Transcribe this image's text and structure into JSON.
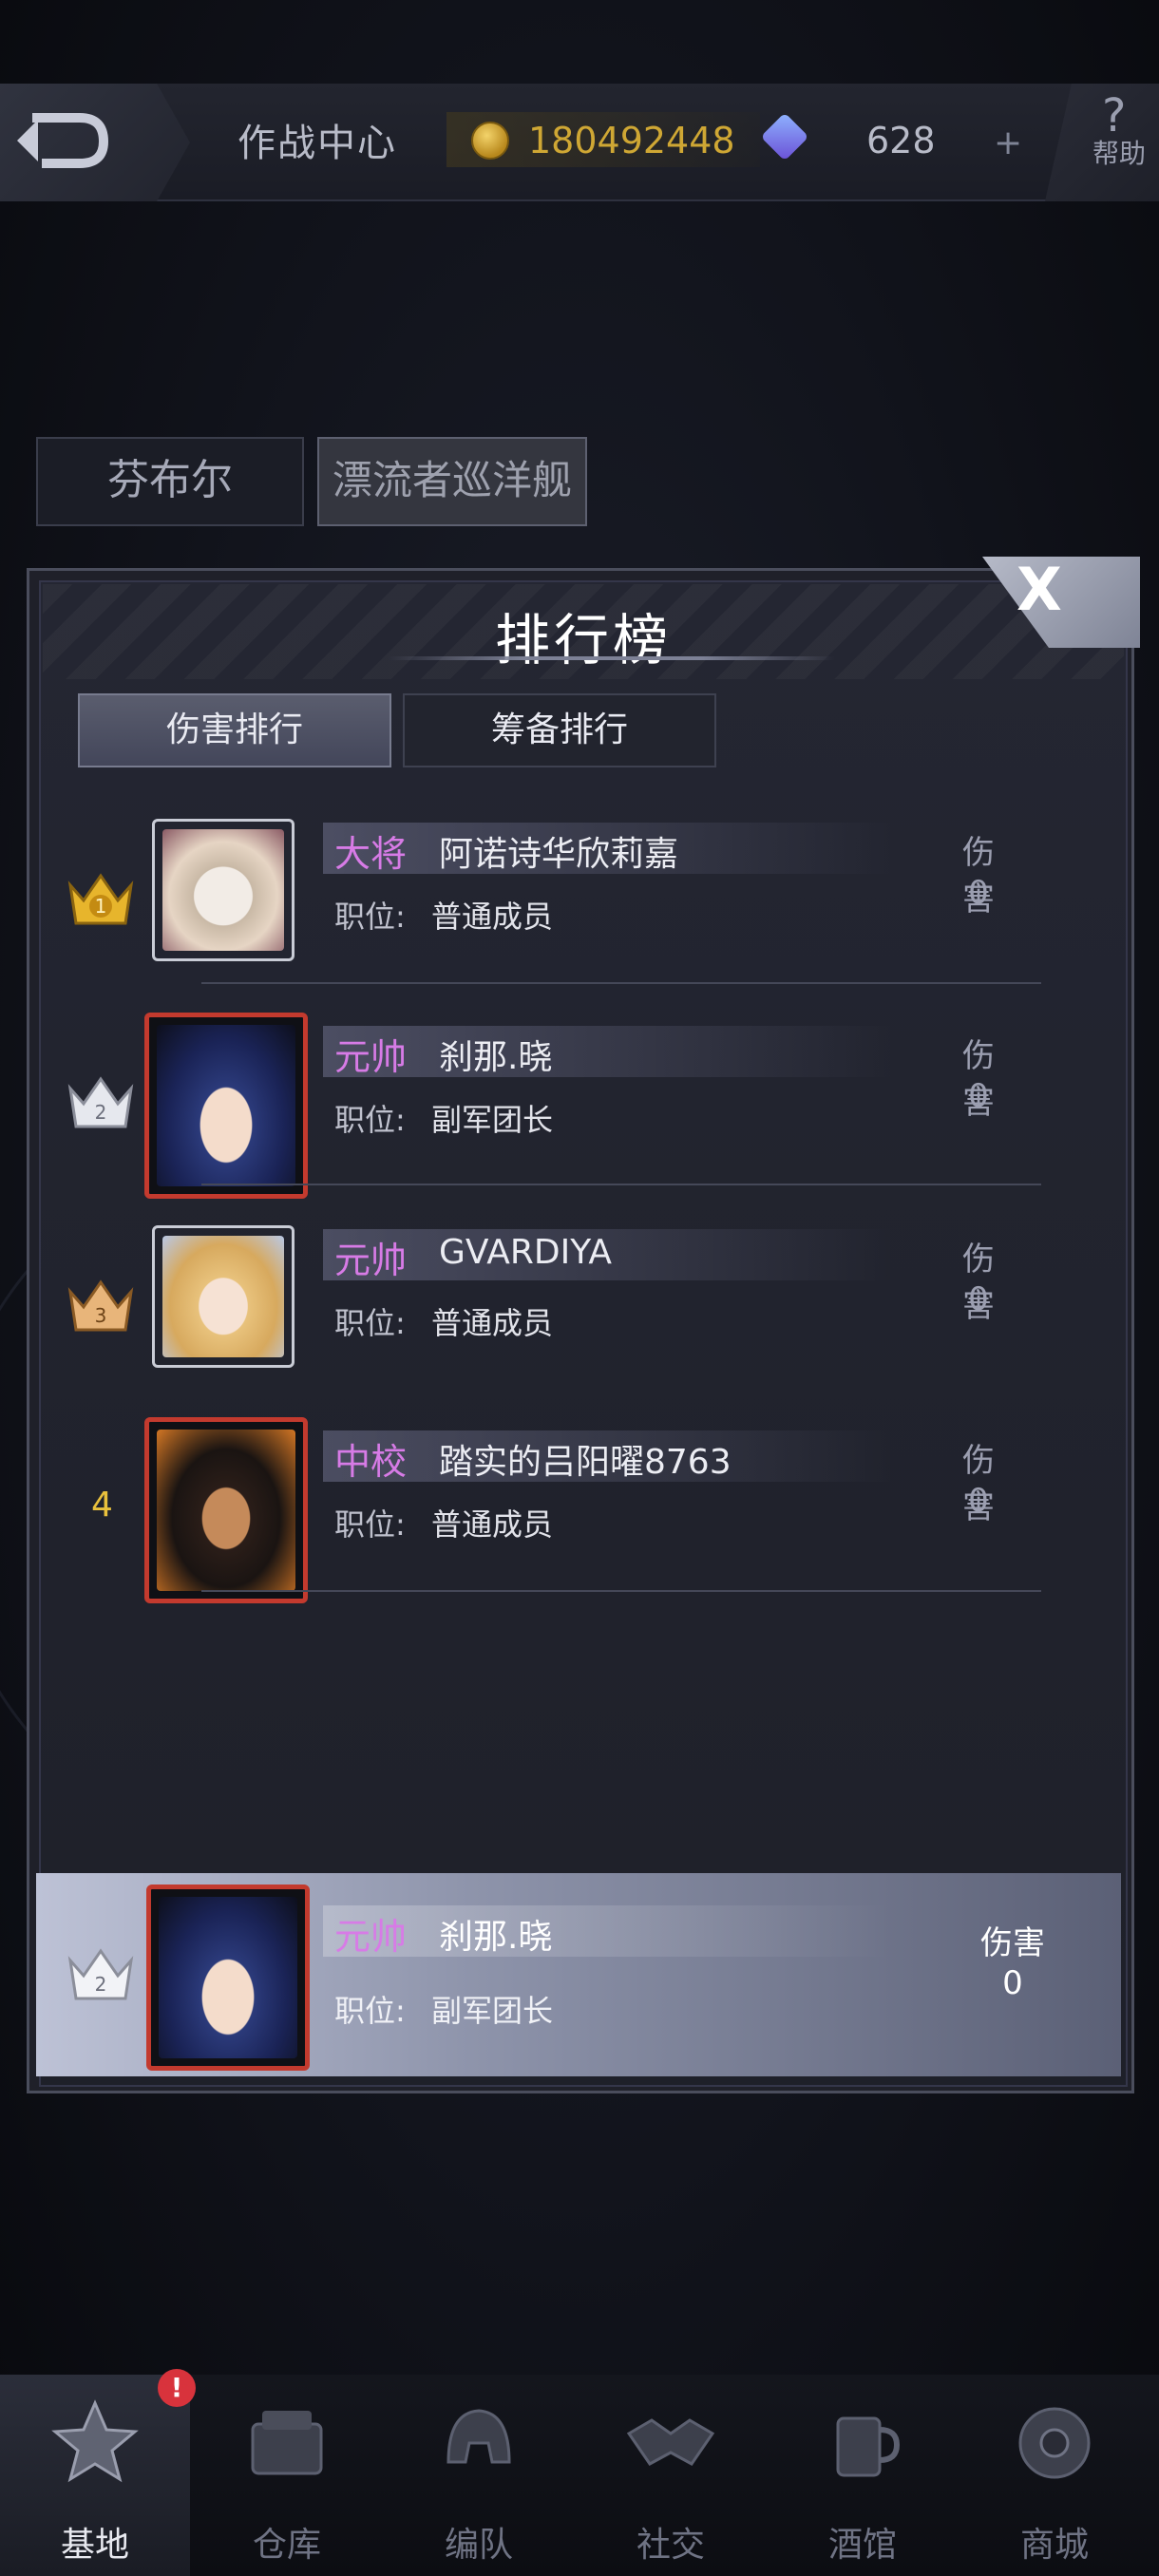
{
  "topbar": {
    "title": "作战中心",
    "gold": "180492448",
    "gems": "628",
    "plus": "+",
    "help": "帮助"
  },
  "categories": [
    {
      "label": "芬布尔",
      "active": false
    },
    {
      "label": "漂流者巡洋舰",
      "active": true
    }
  ],
  "panel": {
    "title": "排行榜",
    "close": "X",
    "tabs": [
      {
        "label": "伤害排行",
        "active": true
      },
      {
        "label": "筹备排行",
        "active": false
      }
    ]
  },
  "rankings": [
    {
      "rank": 1,
      "rank_icon": "gold-crown-icon",
      "title": "大将",
      "name": "阿诺诗华欣莉嘉",
      "post_label": "职位:",
      "post": "普通成员",
      "damage_label": "伤害",
      "damage": "0",
      "avatar": "white-cartoon-avatar"
    },
    {
      "rank": 2,
      "rank_icon": "silver-crown-icon",
      "title": "元帅",
      "name": "刹那.晓",
      "post_label": "职位:",
      "post": "副军团长",
      "damage_label": "伤害",
      "damage": "0",
      "avatar": "blue-haired-girl-avatar"
    },
    {
      "rank": 3,
      "rank_icon": "bronze-crown-icon",
      "title": "元帅",
      "name": "GVARDIYA",
      "post_label": "职位:",
      "post": "普通成员",
      "damage_label": "伤害",
      "damage": "0",
      "avatar": "blonde-girl-avatar"
    },
    {
      "rank": 4,
      "rank_label": "4",
      "title": "中校",
      "name": "踏实的吕阳曜8763",
      "post_label": "职位:",
      "post": "普通成员",
      "damage_label": "伤害",
      "damage": "0",
      "avatar": "dark-haired-man-avatar"
    }
  ],
  "my_rank": {
    "rank": 2,
    "rank_icon": "silver-crown-icon",
    "title": "元帅",
    "name": "刹那.晓",
    "post_label": "职位:",
    "post": "副军团长",
    "damage_label": "伤害",
    "damage": "0"
  },
  "bottom_nav": [
    {
      "label": "基地",
      "icon": "star-emblem-icon",
      "active": true,
      "badge": "!"
    },
    {
      "label": "仓库",
      "icon": "crate-icon",
      "active": false
    },
    {
      "label": "编队",
      "icon": "helmet-icon",
      "active": false
    },
    {
      "label": "社交",
      "icon": "handshake-icon",
      "active": false
    },
    {
      "label": "酒馆",
      "icon": "mug-icon",
      "active": false
    },
    {
      "label": "商城",
      "icon": "shop-orb-icon",
      "active": false
    }
  ],
  "colors": {
    "rank_title": "#d77be6",
    "gold_text": "#cfa734",
    "rank_number": "#e8c03c",
    "badge": "#d8333c"
  }
}
